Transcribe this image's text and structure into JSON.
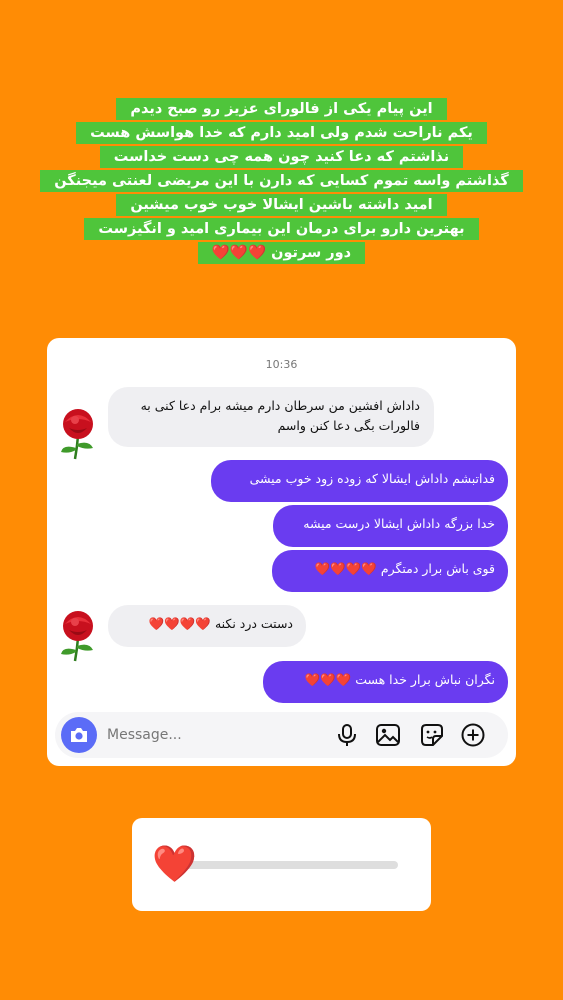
{
  "caption": {
    "lines": [
      "این پیام یکی از فالورای عزیز رو صبح دیدم",
      "یکم ناراحت شدم ولی امید دارم که خدا هواسش هست",
      "نذاشتم که دعا کنید چون همه چی دست خداست",
      "گذاشتم واسه تموم کسایی که دارن با این مریضی لعنتی میجنگن",
      "امید داشته باشین ایشالا خوب خوب میشین",
      "بهترین دارو برای درمان این بیماری امید و انگیزست",
      "دور سرتون ❤️❤️❤️"
    ]
  },
  "chat": {
    "timestamp": "10:36",
    "messages": [
      {
        "side": "in",
        "text": "داداش افشین من سرطان دارم میشه برام دعا کنی به فالورات بگی دعا کنن واسم",
        "line1": "داداش افشین من سرطان دارم میشه برام دعا کنی به",
        "line2": "فالورات بگی دعا کنن واسم"
      },
      {
        "side": "out",
        "text": "فداتبشم داداش ایشالا که زوده زود خوب میشی"
      },
      {
        "side": "out",
        "text": "خدا بزرگه داداش ایشالا درست میشه"
      },
      {
        "side": "out",
        "text": "قوی باش برار دمتگرم",
        "hearts": "❤️❤️❤️❤️"
      },
      {
        "side": "in",
        "text": "دستت درد نکنه",
        "hearts": "❤️❤️❤️❤️"
      },
      {
        "side": "out",
        "text": "نگران نباش برار خدا هست",
        "hearts": "❤️❤️❤️"
      }
    ],
    "avatar_icon": "rose-icon",
    "composer": {
      "placeholder": "Message..."
    },
    "icons": [
      "camera-icon",
      "microphone-icon",
      "image-icon",
      "sticker-icon",
      "plus-circle-icon"
    ],
    "colors": {
      "outgoing": "#6a3cf0",
      "incoming": "#efeff2",
      "camera": "#5b6cf7"
    }
  },
  "slider": {
    "emoji": "❤️",
    "icon": "heart-icon",
    "value": 0.0
  },
  "colors": {
    "background": "#ff8c05",
    "caption_bg": "#4fc53b"
  }
}
